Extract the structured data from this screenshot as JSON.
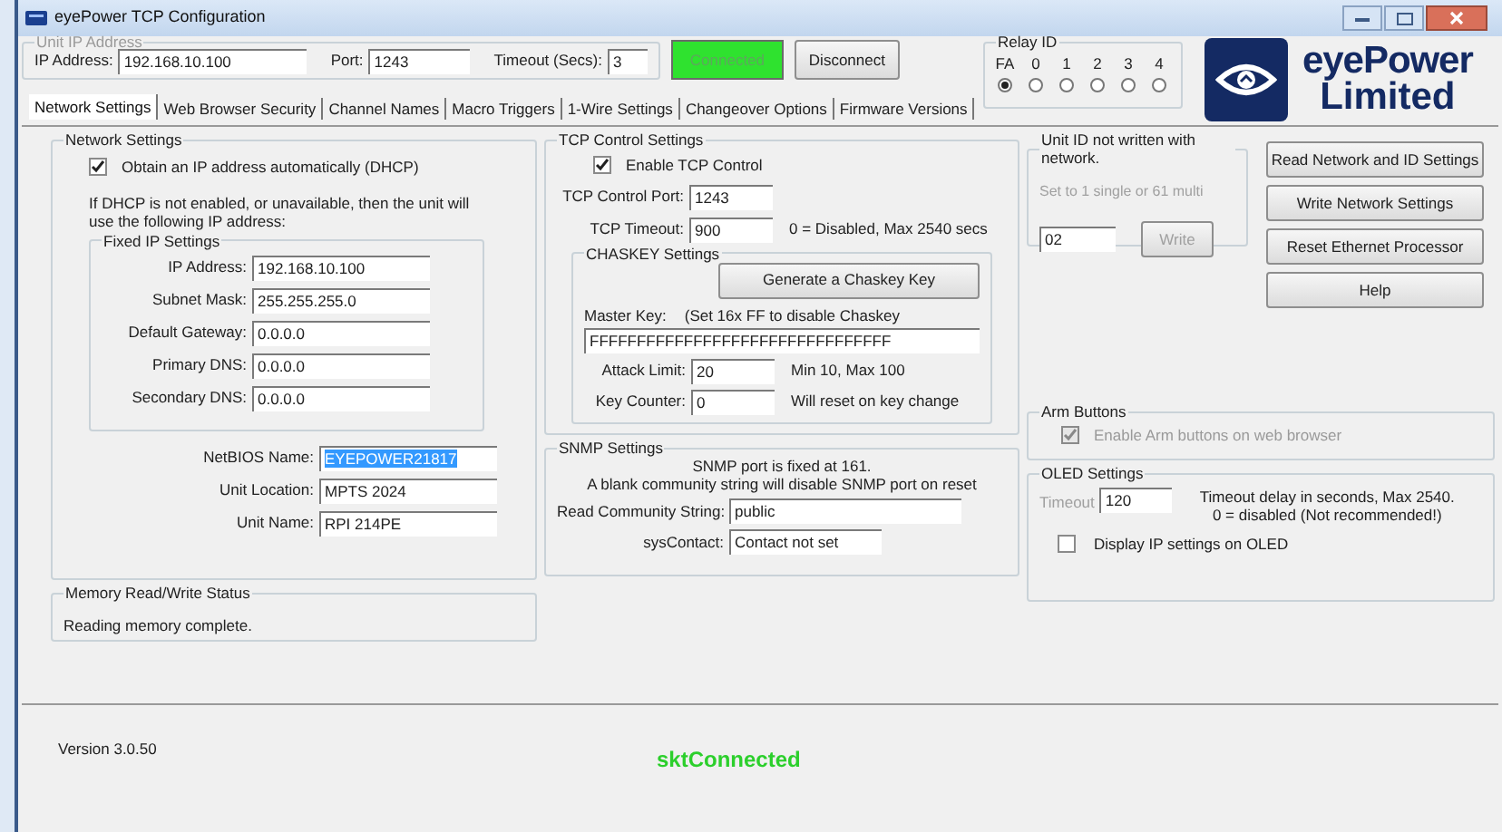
{
  "window": {
    "title": "eyePower TCP Configuration"
  },
  "connection": {
    "legend": "Unit IP Address",
    "fields": [
      {
        "label": "IP Address:",
        "value": "192.168.10.100"
      },
      {
        "label": "Port:",
        "value": "1243"
      },
      {
        "label": "Timeout (Secs):",
        "value": "3"
      }
    ],
    "connected_button": {
      "label": "Connected",
      "disabled": true
    },
    "disconnect_button": {
      "label": "Disconnect",
      "disabled": false
    }
  },
  "relay_id": {
    "legend": "Relay ID",
    "options": [
      {
        "label": "FA",
        "selected": true
      },
      {
        "label": "0",
        "selected": false
      },
      {
        "label": "1",
        "selected": false
      },
      {
        "label": "2",
        "selected": false
      },
      {
        "label": "3",
        "selected": false
      },
      {
        "label": "4",
        "selected": false
      }
    ]
  },
  "logo": {
    "line1": "eyePower",
    "line2": "Limited"
  },
  "tabs": [
    {
      "label": "Network Settings",
      "selected": true
    },
    {
      "label": "Web Browser Security",
      "selected": false
    },
    {
      "label": "Channel Names",
      "selected": false
    },
    {
      "label": "Macro Triggers",
      "selected": false
    },
    {
      "label": "1-Wire Settings",
      "selected": false
    },
    {
      "label": "Changeover Options",
      "selected": false
    },
    {
      "label": "Firmware Versions",
      "selected": false
    }
  ],
  "network_settings": {
    "legend": "Network Settings",
    "dhcp": {
      "label": "Obtain an IP address automatically (DHCP)",
      "checked": true
    },
    "note": "If DHCP is not enabled, or unavailable, then the unit will use the following IP address:",
    "fixed": {
      "legend": "Fixed IP Settings",
      "fields": [
        {
          "label": "IP Address:",
          "value": "192.168.10.100"
        },
        {
          "label": "Subnet Mask:",
          "value": "255.255.255.0"
        },
        {
          "label": "Default Gateway:",
          "value": "0.0.0.0"
        },
        {
          "label": "Primary DNS:",
          "value": "0.0.0.0"
        },
        {
          "label": "Secondary DNS:",
          "value": "0.0.0.0"
        }
      ]
    },
    "name_fields": [
      {
        "label": "NetBIOS Name:",
        "value": "EYEPOWER21817",
        "selected": true
      },
      {
        "label": "Unit Location:",
        "value": "MPTS 2024",
        "selected": false
      },
      {
        "label": "Unit Name:",
        "value": "RPI 214PE",
        "selected": false
      }
    ]
  },
  "memory_status": {
    "legend": "Memory Read/Write Status",
    "text": "Reading memory complete."
  },
  "tcp_control": {
    "legend": "TCP Control Settings",
    "enable": {
      "label": "Enable TCP Control",
      "checked": true
    },
    "port": {
      "label": "TCP Control Port:",
      "value": "1243"
    },
    "timeout": {
      "label": "TCP Timeout:",
      "value": "900",
      "hint": "0 = Disabled, Max 2540 secs"
    },
    "chaskey": {
      "legend": "CHASKEY Settings",
      "generate_button": "Generate a Chaskey Key",
      "key_label": "Master Key:",
      "key_hint": "(Set 16x FF to disable Chaskey",
      "key": "FFFFFFFFFFFFFFFFFFFFFFFFFFFFFFFF",
      "fields": [
        {
          "label": "Attack Limit:",
          "value": "20",
          "hint": "Min 10,  Max 100"
        },
        {
          "label": "Key Counter:",
          "value": "0",
          "hint": "Will reset on key change"
        }
      ]
    }
  },
  "snmp": {
    "legend": "SNMP Settings",
    "notes": [
      "SNMP port is fixed at 161.",
      "A blank community string will disable SNMP port on reset"
    ],
    "fields": [
      {
        "label": "Read Community String:",
        "value": "public"
      },
      {
        "label": "sysContact:",
        "value": "Contact not set"
      }
    ]
  },
  "unit_id": {
    "legend": "Unit ID not written with network.",
    "hint": "Set to 1 single or 61 multi",
    "value": "02",
    "write_button": {
      "label": "Write",
      "disabled": true
    }
  },
  "actions": [
    "Read Network and ID Settings",
    "Write Network Settings",
    "Reset Ethernet Processor",
    "Help"
  ],
  "arm_buttons": {
    "legend": "Arm Buttons",
    "option": {
      "label": "Enable Arm buttons on web browser",
      "checked": true,
      "disabled": true
    }
  },
  "oled": {
    "legend": "OLED Settings",
    "timeout_label": "Timeout",
    "timeout": "120",
    "hint_lines": [
      "Timeout delay in seconds, Max 2540.",
      "0 = disabled (Not recommended!)"
    ],
    "display_ip": {
      "label": "Display IP settings on OLED",
      "checked": false
    }
  },
  "status_bar": {
    "version": "Version 3.0.50",
    "connection": "sktConnected"
  }
}
